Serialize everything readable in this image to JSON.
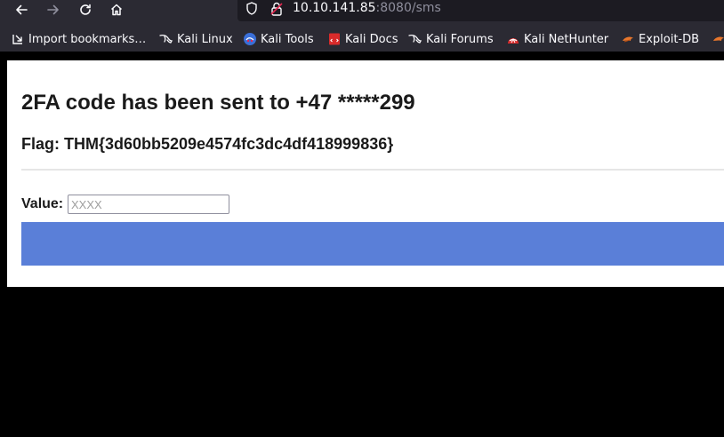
{
  "browser": {
    "url_host": "10.10.141.85",
    "url_rest": ":8080/sms"
  },
  "bookmarks": [
    {
      "label": "Import bookmarks…",
      "icon": "import-icon"
    },
    {
      "label": "Kali Linux",
      "icon": "kali-dragon-icon"
    },
    {
      "label": "Kali Tools",
      "icon": "kali-tools-icon"
    },
    {
      "label": "Kali Docs",
      "icon": "kali-docs-icon"
    },
    {
      "label": "Kali Forums",
      "icon": "kali-dragon-icon"
    },
    {
      "label": "Kali NetHunter",
      "icon": "nethunter-icon"
    },
    {
      "label": "Exploit-DB",
      "icon": "exploit-db-icon"
    }
  ],
  "page": {
    "heading": "2FA code has been sent to +47 *****299",
    "flag": "Flag: THM{3d60bb5209e4574fc3dc4df418999836}",
    "value_label": "Value:",
    "value_input": {
      "value": "",
      "placeholder": "XXXX"
    },
    "submit_label": ""
  },
  "colors": {
    "toolbar_bg": "#2b2a33",
    "urlbar_bg": "#1c1b22",
    "submit_button": "#5a7fd8",
    "page_bg": "#ffffff",
    "outside_bg": "#000000"
  }
}
